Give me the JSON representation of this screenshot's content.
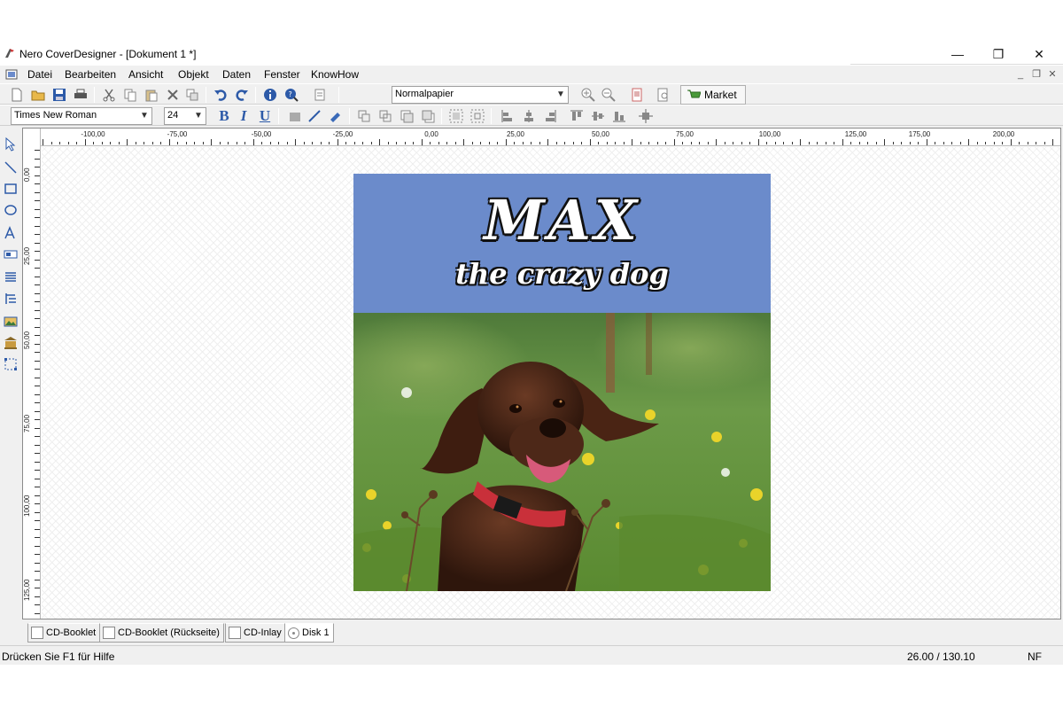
{
  "window": {
    "title": "Nero CoverDesigner - [Dokument 1 *]",
    "minimize": "—",
    "restore": "❐",
    "close": "✕",
    "mdi_minimize": "_",
    "mdi_restore": "❐",
    "mdi_close": "✕"
  },
  "menu": [
    "Datei",
    "Bearbeiten",
    "Ansicht",
    "Objekt",
    "Daten",
    "Fenster",
    "KnowHow"
  ],
  "toolbar": {
    "paper_select": "Normalpapier",
    "market_label": "Market",
    "font_family": "Times New Roman",
    "font_size": "24",
    "bold": "B",
    "italic": "I",
    "underline": "U"
  },
  "ruler": {
    "horizontal": [
      "-100,00",
      "-75,00",
      "-50,00",
      "-25,00",
      "0,00",
      "25,00",
      "50,00",
      "75,00",
      "100,00",
      "125,00",
      "175,00",
      "200,00"
    ],
    "vertical": [
      "0,00",
      "25,00",
      "50,00",
      "75,00",
      "100,00",
      "125,00"
    ]
  },
  "cover": {
    "title": "MAX",
    "subtitle": "the crazy dog",
    "header_color": "#6b8bcb"
  },
  "tabs": [
    "CD-Booklet",
    "CD-Booklet (Rückseite)",
    "CD-Inlay",
    "Disk 1"
  ],
  "status": {
    "help": "Drücken Sie F1 für Hilfe",
    "coords": "26.00 / 130.10",
    "mode": "NF"
  }
}
